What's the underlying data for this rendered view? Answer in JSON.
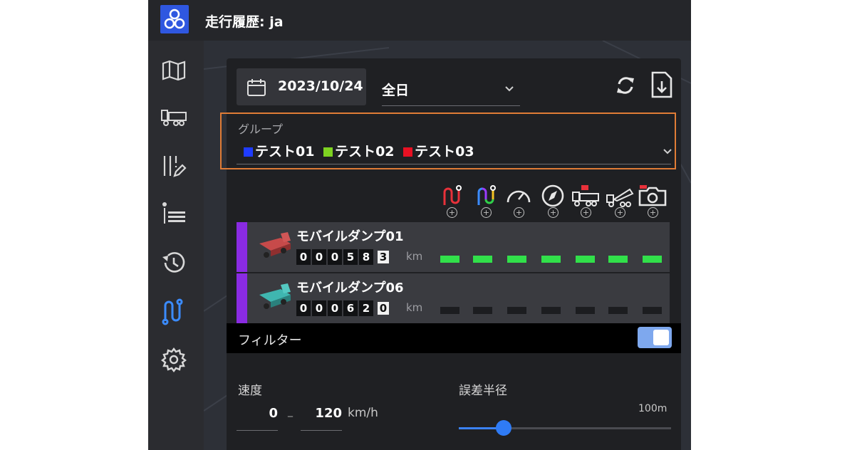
{
  "app": {
    "title": "走行履歴: ja"
  },
  "nav": [
    {
      "icon": "map-icon"
    },
    {
      "icon": "truck-icon"
    },
    {
      "icon": "edit-list-icon"
    },
    {
      "icon": "list-icon"
    },
    {
      "icon": "history-icon"
    },
    {
      "icon": "route-icon",
      "active": true
    },
    {
      "icon": "gear-icon"
    }
  ],
  "toolbar": {
    "date": "2023/10/24",
    "range": "全日"
  },
  "group": {
    "label": "グループ",
    "items": [
      {
        "name": "テスト01",
        "color": "#1f3cff"
      },
      {
        "name": "テスト02",
        "color": "#7ed321"
      },
      {
        "name": "テスト03",
        "color": "#e81123"
      }
    ]
  },
  "tools": [
    "route-icon",
    "route-multicolor-icon",
    "speedometer-icon",
    "compass-icon",
    "truck-alert-icon",
    "dump-truck-icon",
    "camera-icon"
  ],
  "vehicles": [
    {
      "name": "モバイルダンプ01",
      "digits": [
        "0",
        "0",
        "0",
        "5",
        "8"
      ],
      "decimal": "3",
      "unit": "km",
      "body_color": "#c74a4a",
      "indicators_on": true
    },
    {
      "name": "モバイルダンプ06",
      "digits": [
        "0",
        "0",
        "0",
        "6",
        "2"
      ],
      "decimal": "0",
      "unit": "km",
      "body_color": "#3fb6b0",
      "indicators_on": false
    }
  ],
  "filter": {
    "label": "フィルター",
    "enabled": true
  },
  "speed": {
    "label": "速度",
    "min": "0",
    "max": "120",
    "unit": "km/h"
  },
  "error_radius": {
    "label": "誤差半径",
    "max_label": "100m",
    "value_fraction": 0.21
  },
  "colors": {
    "accent": "#2f57e0",
    "highlight_border": "#e07c36",
    "indicator_on": "#31e04a",
    "indicator_off": "#1c1d20",
    "row_accent": "#8a2be2"
  }
}
